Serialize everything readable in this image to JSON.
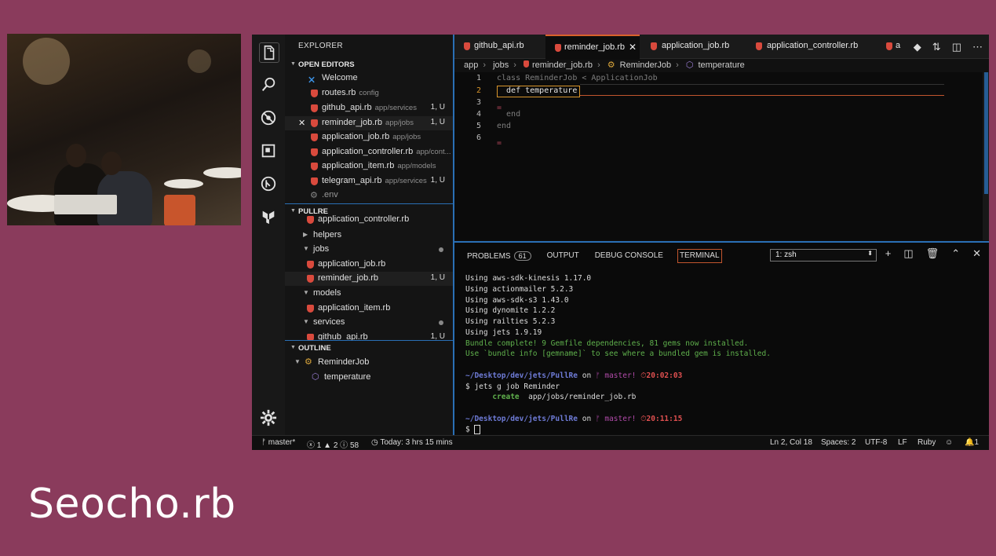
{
  "event_title": "Seocho.rb",
  "sidebar": {
    "title": "EXPLORER",
    "open_editors_label": "OPEN EDITORS",
    "open_editors": [
      {
        "name": "Welcome",
        "path": "",
        "badge": ""
      },
      {
        "name": "routes.rb",
        "path": "config",
        "badge": ""
      },
      {
        "name": "github_api.rb",
        "path": "app/services",
        "badge": "1, U"
      },
      {
        "name": "reminder_job.rb",
        "path": "app/jobs",
        "badge": "1, U"
      },
      {
        "name": "application_job.rb",
        "path": "app/jobs",
        "badge": ""
      },
      {
        "name": "application_controller.rb",
        "path": "app/cont...",
        "badge": ""
      },
      {
        "name": "application_item.rb",
        "path": "app/models",
        "badge": ""
      },
      {
        "name": "telegram_api.rb",
        "path": "app/services",
        "badge": "1, U"
      },
      {
        "name": ".env",
        "path": "",
        "badge": ""
      }
    ],
    "project_label": "PULLRE",
    "project_items": [
      {
        "name": "application_controller.rb",
        "badge": ""
      },
      {
        "name": "helpers",
        "badge": ""
      },
      {
        "name": "jobs",
        "badge": ""
      },
      {
        "name": "application_job.rb",
        "badge": ""
      },
      {
        "name": "reminder_job.rb",
        "badge": "1, U"
      },
      {
        "name": "models",
        "badge": ""
      },
      {
        "name": "application_item.rb",
        "badge": ""
      },
      {
        "name": "services",
        "badge": ""
      },
      {
        "name": "github_api.rb",
        "badge": "1, U"
      }
    ],
    "outline_label": "OUTLINE",
    "outline_items": [
      {
        "name": "ReminderJob"
      },
      {
        "name": "temperature"
      }
    ]
  },
  "tabs": [
    {
      "label": "github_api.rb"
    },
    {
      "label": "reminder_job.rb"
    },
    {
      "label": "application_job.rb"
    },
    {
      "label": "application_controller.rb"
    },
    {
      "label": "a"
    }
  ],
  "breadcrumb": [
    "app",
    "jobs",
    "reminder_job.rb",
    "ReminderJob",
    "temperature"
  ],
  "editor": {
    "line_numbers": [
      "1",
      "2",
      "3",
      "4",
      "5",
      "6"
    ],
    "lines": [
      "class ReminderJob < ApplicationJob",
      "  def temperature",
      "",
      "  end",
      "end",
      ""
    ]
  },
  "panel": {
    "tabs": [
      "PROBLEMS",
      "OUTPUT",
      "DEBUG CONSOLE",
      "TERMINAL"
    ],
    "problems_count": "61",
    "terminal_select": "1: zsh",
    "terminal_lines": [
      "Using aws-sdk-kinesis 1.17.0",
      "Using actionmailer 5.2.3",
      "Using aws-sdk-s3 1.43.0",
      "Using dynomite 1.2.2",
      "Using railties 5.2.3",
      "Using jets 1.9.19"
    ],
    "bundle_complete": "Bundle complete! 9 Gemfile dependencies, 81 gems now installed.",
    "bundle_info": "Use `bundle info [gemname]` to see where a bundled gem is installed.",
    "prompt1": {
      "path": "~/Desktop/dev/jets/PullRe",
      "on": "on",
      "branch": "master!",
      "time": "20:02:03"
    },
    "command": "$ jets g job Reminder",
    "create_label": "create",
    "create_path": "app/jobs/reminder_job.rb",
    "prompt2": {
      "path": "~/Desktop/dev/jets/PullRe",
      "on": "on",
      "branch": "master!",
      "time": "20:11:15"
    },
    "cursor_prompt": "$"
  },
  "status": {
    "branch": "master*",
    "errors": "1",
    "warnings": "2",
    "infos": "58",
    "time_today": "Today: 3 hrs 15 mins",
    "position": "Ln 2, Col 18",
    "spaces": "Spaces: 2",
    "encoding": "UTF-8",
    "eol": "LF",
    "language": "Ruby",
    "notifications": "1"
  },
  "colors": {
    "background": "#8a3b5c",
    "accent_blue": "#2a6fb5",
    "ruby_red": "#d94a3d",
    "active_tab_orange": "#d9622b"
  }
}
